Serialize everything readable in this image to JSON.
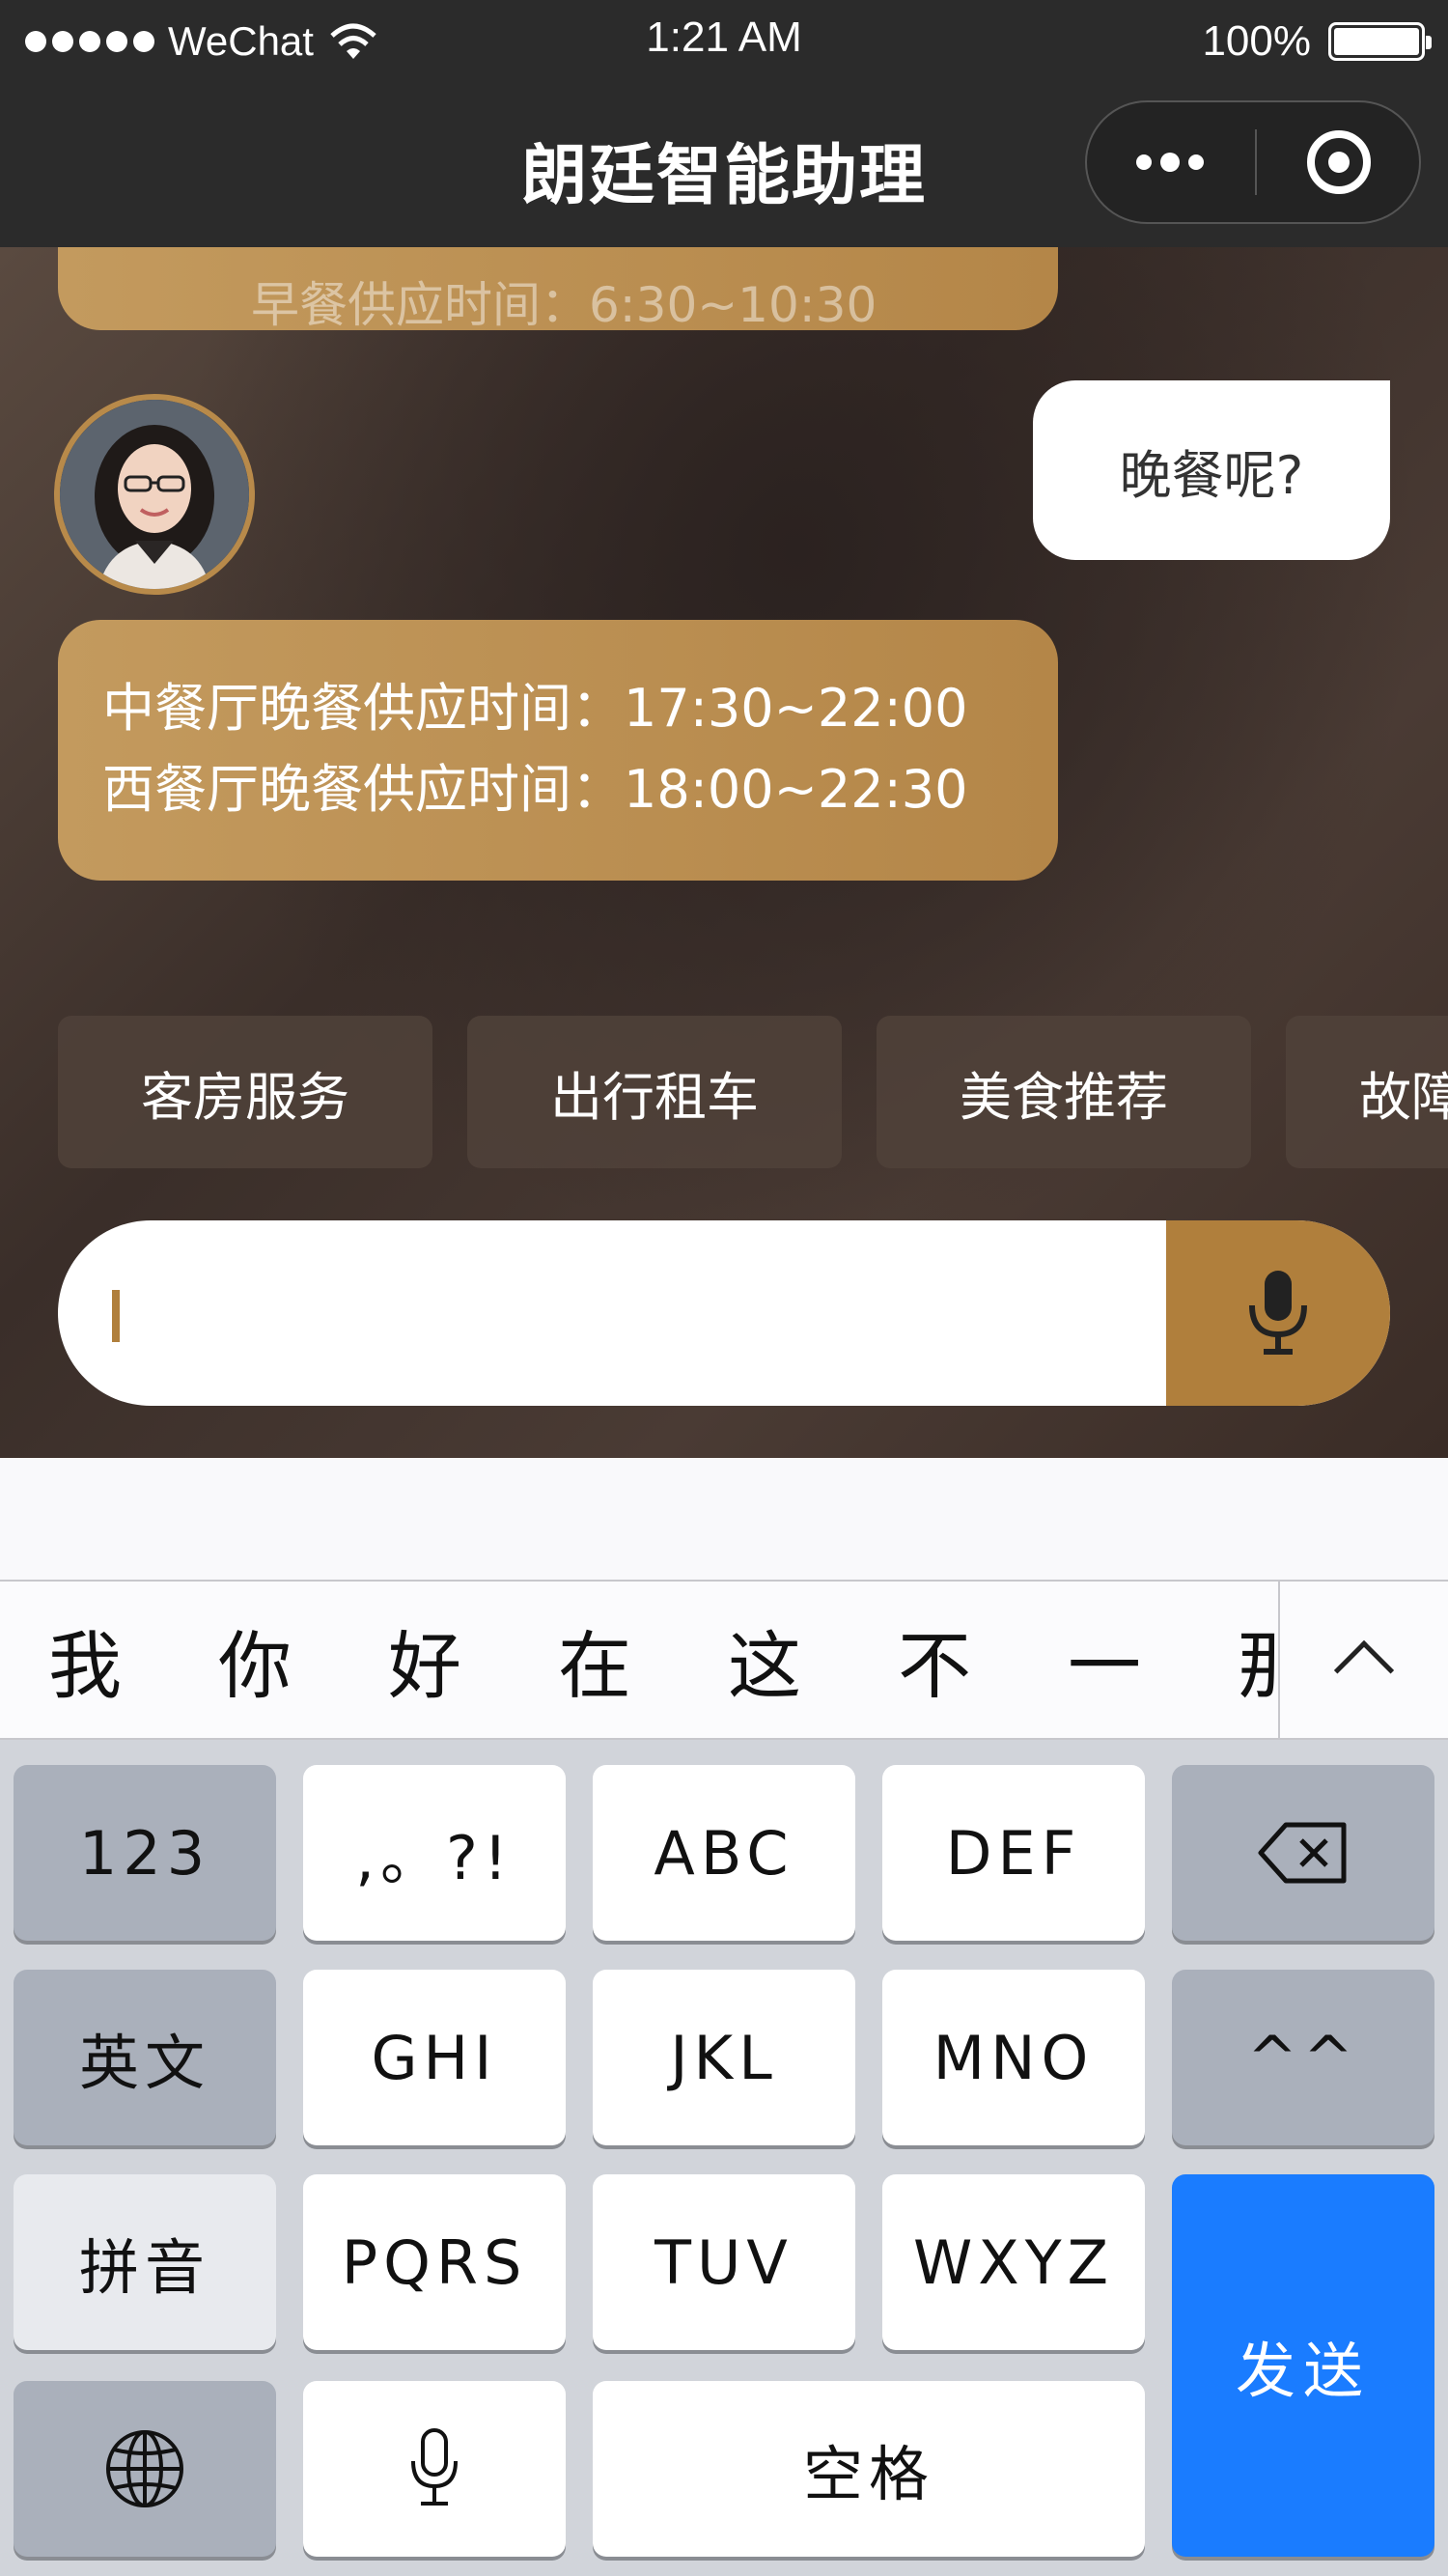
{
  "status_bar": {
    "carrier": "WeChat",
    "time": "1:21 AM",
    "battery": "100%",
    "signal_bars": 5
  },
  "nav": {
    "title": "朗廷智能助理",
    "more_icon": "more-dots-icon",
    "close_icon": "target-close-icon"
  },
  "chat": {
    "previous_bubble_fragment": "早餐供应时间：6:30~10:30",
    "user_message": "晚餐呢?",
    "bot_reply_line1": "中餐厅晚餐供应时间：17:30~22:00",
    "bot_reply_line2": "西餐厅晚餐供应时间：18:00~22:30"
  },
  "quick_replies": [
    "客房服务",
    "出行租车",
    "美食推荐",
    "故障"
  ],
  "input": {
    "value": "",
    "mic_icon": "microphone-icon"
  },
  "candidates": [
    "我",
    "你",
    "好",
    "在",
    "这",
    "不",
    "一",
    "那"
  ],
  "keyboard": {
    "row1": [
      "123",
      ",。?!",
      "ABC",
      "DEF",
      "⌫"
    ],
    "row2": [
      "英文",
      "GHI",
      "JKL",
      "MNO",
      "^^"
    ],
    "row3": [
      "拼音",
      "PQRS",
      "TUV",
      "WXYZ"
    ],
    "row4_space": "空格",
    "send": "发送"
  },
  "colors": {
    "accent": "#b07f3c",
    "send_blue": "#1a7cff",
    "nav_bg": "#2b2b2b"
  }
}
